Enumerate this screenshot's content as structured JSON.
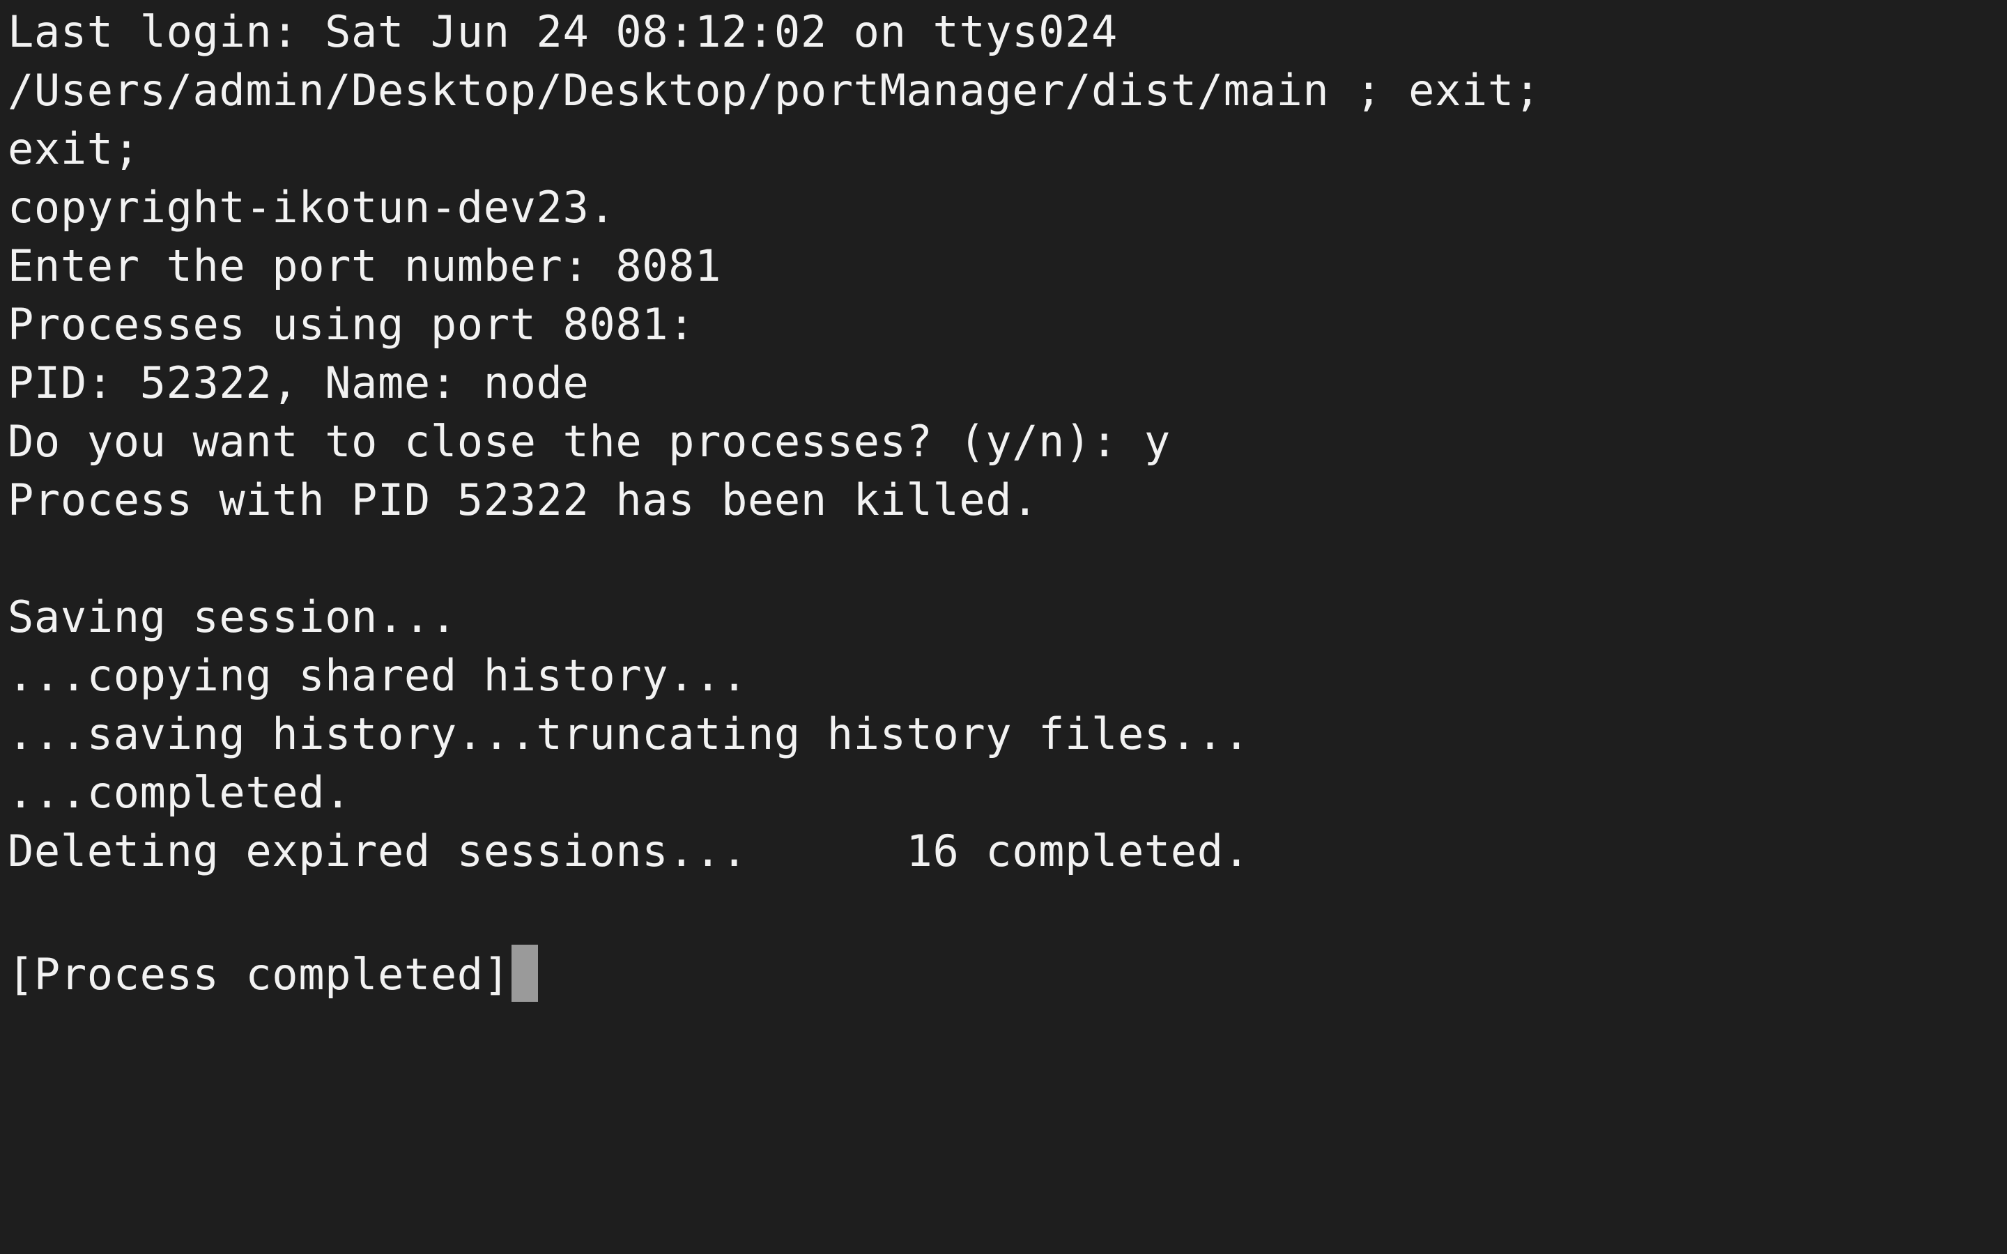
{
  "terminal": {
    "lines": [
      "Last login: Sat Jun 24 08:12:02 on ttys024",
      "/Users/admin/Desktop/Desktop/portManager/dist/main ; exit;",
      "exit;",
      "copyright-ikotun-dev23.",
      "Enter the port number: 8081",
      "Processes using port 8081:",
      "PID: 52322, Name: node",
      "Do you want to close the processes? (y/n): y",
      "Process with PID 52322 has been killed.",
      "",
      "Saving session...",
      "...copying shared history...",
      "...saving history...truncating history files...",
      "...completed.",
      "Deleting expired sessions...      16 completed.",
      "",
      "[Process completed]"
    ],
    "cursor_color": "#9a9a9a",
    "background_color": "#1e1e1e",
    "text_color": "#f2f2f2"
  }
}
